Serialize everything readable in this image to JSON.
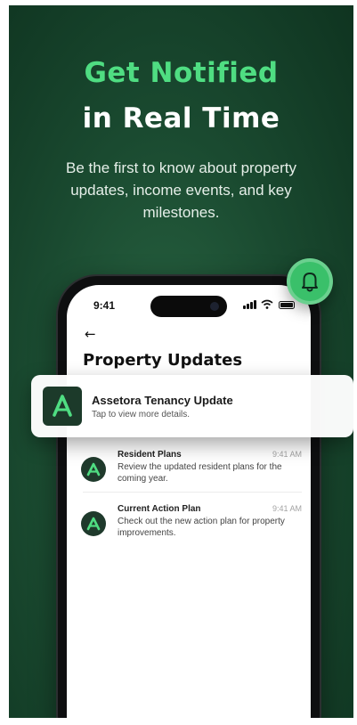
{
  "hero": {
    "headline_line1": "Get Notified",
    "headline_line2": "in Real Time",
    "subtitle": "Be the first to know about property updates, income events, and key milestones."
  },
  "icons": {
    "badge": "bell-icon",
    "back": "back-arrow-icon",
    "logo": "assetora-logo-icon"
  },
  "phone": {
    "status_time": "9:41",
    "back_arrow": "←",
    "page_title": "Property Updates"
  },
  "banner": {
    "title": "Assetora Tenancy Update",
    "subtitle": "Tap to view more details."
  },
  "notifications": [
    {
      "title": "Resident Plans",
      "time": "9:41 AM",
      "body": "Review the updated resident plans for the coming year."
    },
    {
      "title": "Current Action Plan",
      "time": "9:41 AM",
      "body": "Check out the new action plan for property improvements."
    }
  ],
  "colors": {
    "background": "#1a4a30",
    "accent_green": "#4fdd82",
    "badge_green": "#3ac06a",
    "logo_dark": "#1c3a2a"
  }
}
